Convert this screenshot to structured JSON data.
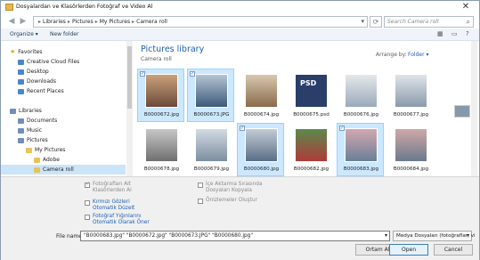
{
  "window": {
    "title": "Dosyalardan ve Klasörlerden Fotoğraf ve Video Al",
    "close_glyph": "✕"
  },
  "address": {
    "crumbs": [
      "Libraries",
      "Pictures",
      "My Pictures",
      "Camera roll"
    ],
    "search_placeholder": "Search Camera roll"
  },
  "toolbar": {
    "organize": "Organize ▾",
    "new_folder": "New folder",
    "icons": [
      "view-icon",
      "preview-pane-icon",
      "help-icon"
    ]
  },
  "nav": {
    "items": [
      {
        "label": "Favorites",
        "icon": "star",
        "indent": 0
      },
      {
        "label": "Creative Cloud Files",
        "icon": "blue",
        "indent": 1
      },
      {
        "label": "Desktop",
        "icon": "blue",
        "indent": 1
      },
      {
        "label": "Downloads",
        "icon": "blue",
        "indent": 1
      },
      {
        "label": "Recent Places",
        "icon": "blue",
        "indent": 1
      },
      {
        "label": "",
        "icon": "",
        "indent": 0
      },
      {
        "label": "Libraries",
        "icon": "lib",
        "indent": 0
      },
      {
        "label": "Documents",
        "icon": "lib",
        "indent": 1
      },
      {
        "label": "Music",
        "icon": "lib",
        "indent": 1
      },
      {
        "label": "Pictures",
        "icon": "lib",
        "indent": 1
      },
      {
        "label": "My Pictures",
        "icon": "folder",
        "indent": 2
      },
      {
        "label": "Adobe",
        "icon": "folder",
        "indent": 3
      },
      {
        "label": "Camera roll",
        "icon": "folder",
        "indent": 3,
        "selected": true
      },
      {
        "label": "Gaura Ma",
        "icon": "folder",
        "indent": 3
      }
    ]
  },
  "content": {
    "library_title": "Pictures library",
    "library_sub": "Camera roll",
    "arrange_label": "Arrange by:",
    "arrange_value": "Folder ▾",
    "tiles": [
      {
        "name": "B0000672.jpg",
        "selected": true,
        "colors": [
          "#6b4a3a",
          "#c9a27a"
        ]
      },
      {
        "name": "B0000673.JPG",
        "selected": true,
        "colors": [
          "#3d5a7a",
          "#b5c4d4"
        ]
      },
      {
        "name": "B0000674.jpg",
        "selected": false,
        "colors": [
          "#8a6a4a",
          "#d8c8b0"
        ]
      },
      {
        "name": "B0000675.psd",
        "selected": false,
        "psd": true
      },
      {
        "name": "B0000676.jpg",
        "selected": false,
        "colors": [
          "#9aaabb",
          "#e6e8ea"
        ]
      },
      {
        "name": "B0000677.jpg",
        "selected": false,
        "colors": [
          "#8a9aaa",
          "#dfe4e9"
        ]
      },
      {
        "name": "B0000678.jpg",
        "selected": false,
        "colors": [
          "#6f6f6f",
          "#c7c7c7"
        ]
      },
      {
        "name": "B0000679.jpg",
        "selected": false,
        "colors": [
          "#7c8ea0",
          "#d3dbe3"
        ]
      },
      {
        "name": "B0000680.jpg",
        "selected": true,
        "colors": [
          "#5a6e86",
          "#c3ccd6"
        ]
      },
      {
        "name": "B0000682.jpg",
        "selected": false,
        "colors": [
          "#b03a3a",
          "#5a8a4a"
        ]
      },
      {
        "name": "B0000683.jpg",
        "selected": true,
        "colors": [
          "#6a7f96",
          "#d2a8b0"
        ]
      },
      {
        "name": "B0000684.jpg",
        "selected": false,
        "colors": [
          "#6a7a8c",
          "#cfa8a8"
        ]
      }
    ]
  },
  "options": {
    "items": [
      {
        "label": "Fotoğrafları Alt\nKlasörlerden Al",
        "checked": true,
        "disabled": true,
        "link": false
      },
      {
        "label": "Kırmızı Gözleri\nOtomatik Düzelt",
        "checked": false,
        "disabled": false,
        "link": true
      },
      {
        "label": "Fotoğraf Yığınlarını\nOtomatik Olarak Öner",
        "checked": false,
        "disabled": false,
        "link": true
      },
      {
        "label": "İçe Aktarma Sırasında\nDosyaları Kopyala",
        "checked": false,
        "disabled": true,
        "link": false
      },
      {
        "label": "Önizlemeler Oluştur",
        "checked": false,
        "disabled": true,
        "link": false
      }
    ]
  },
  "filebar": {
    "file_name_label": "File name:",
    "file_name_value": "\"B0000683.jpg\" \"B0000672.jpg\" \"B0000673.JPG\" \"B0000680.jpg\"",
    "file_type_value": "Medya Dosyaları (fotoğraflar, vi",
    "btn_ortam": "Ortam Al",
    "btn_open": "Open",
    "btn_cancel": "Cancel"
  }
}
